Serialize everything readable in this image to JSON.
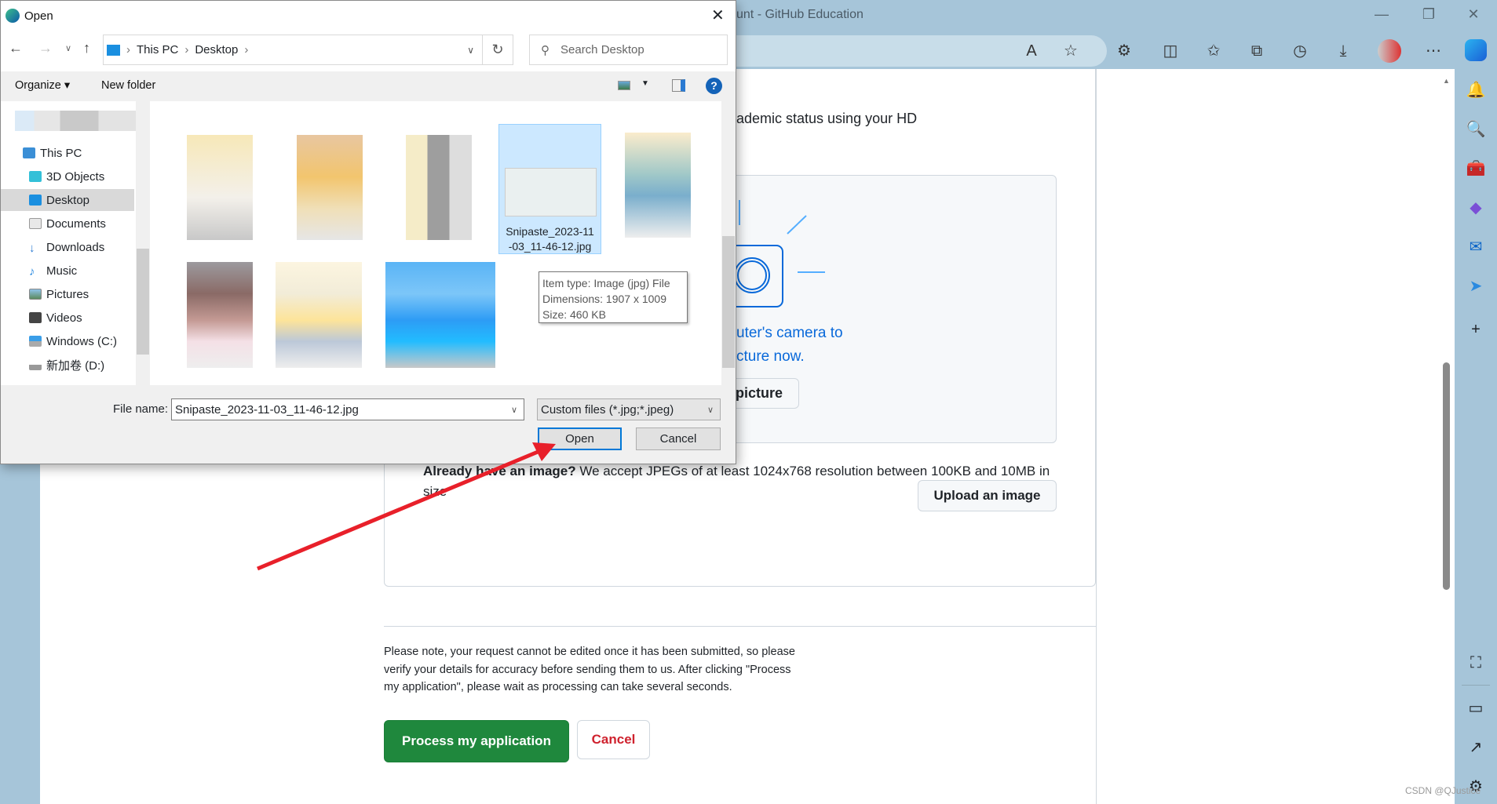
{
  "browser": {
    "title": "unt - GitHub Education",
    "watermark": "CSDN @QJustice",
    "toolbar_icons": [
      "read-aloud-icon",
      "favorite-star-icon",
      "extensions-icon",
      "split-screen-icon",
      "favorites-icon",
      "collections-icon",
      "history-icon",
      "download-icon",
      "profile-avatar",
      "more-icon",
      "copilot-icon"
    ],
    "sidebar_icons": [
      "notification-bell-icon",
      "search-icon",
      "toolbox-icon",
      "office-icon",
      "outlook-icon",
      "send-icon",
      "add-icon",
      "screenshot-icon",
      "sidebar-toggle-icon",
      "open-external-icon",
      "settings-icon"
    ]
  },
  "page": {
    "intro": "ademic status using your HD",
    "camera_text_1": "uter's camera to",
    "camera_text_2": "cture now.",
    "take_picture": "picture",
    "already_bold": "Already have an image?",
    "already_rest": " We accept JPEGs of at least 1024x768 resolution between 100KB and 10MB in size",
    "upload": "Upload an image",
    "note": "Please note, your request cannot be edited once it has been submitted, so please verify your details for accuracy before sending them to us. After clicking \"Process my application\", please wait as processing can take several seconds.",
    "process": "Process my application",
    "cancel": "Cancel",
    "accent_green": "#1f883d",
    "accent_red": "#cf222e"
  },
  "dialog": {
    "title": "Open",
    "breadcrumb": [
      "This PC",
      "Desktop"
    ],
    "search_placeholder": "Search Desktop",
    "organize": "Organize",
    "new_folder": "New folder",
    "nav": [
      "This PC",
      "3D Objects",
      "Desktop",
      "Documents",
      "Downloads",
      "Music",
      "Pictures",
      "Videos",
      "Windows (C:)",
      "新加卷 (D:)"
    ],
    "selected_nav": "Desktop",
    "selected_file": "Snipaste_2023-11-03_11-46-12.jpg",
    "selected_file_l1": "Snipaste_2023-11",
    "selected_file_l2": "-03_11-46-12.jpg",
    "tooltip": [
      "Item type: Image (jpg) File",
      "Dimensions: 1907 x 1009",
      "Size: 460 KB"
    ],
    "file_name_label": "File name:",
    "file_name_value": "Snipaste_2023-11-03_11-46-12.jpg",
    "filter": "Custom files (*.jpg;*.jpeg)",
    "open": "Open",
    "cancel": "Cancel"
  }
}
